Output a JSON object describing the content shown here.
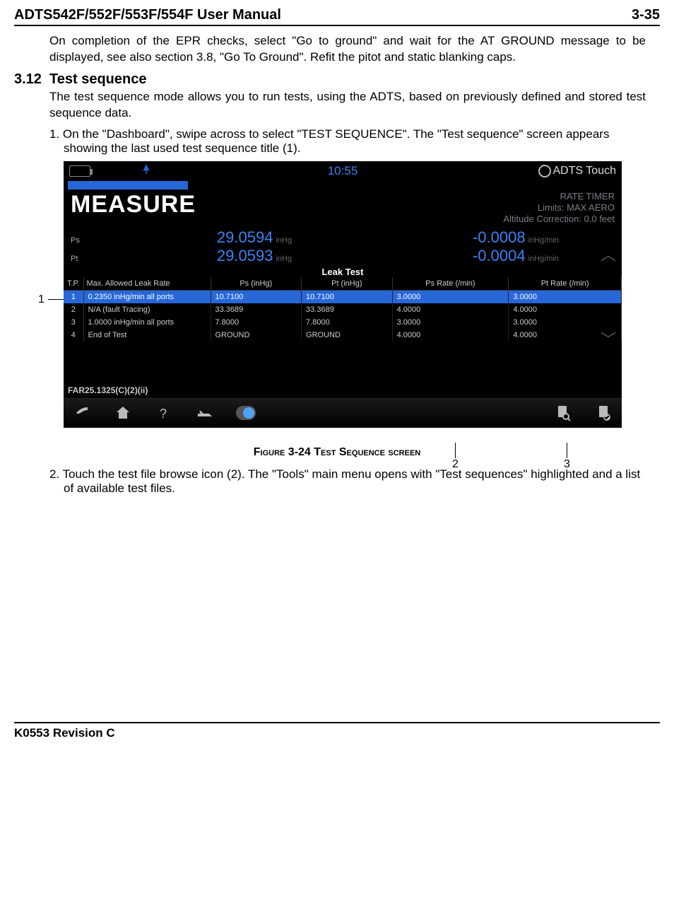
{
  "header": {
    "title": "ADTS542F/552F/553F/554F User Manual",
    "pagenum": "3-35"
  },
  "para_pre": "On completion of the EPR checks, select \"Go to ground\" and wait for the AT GROUND message to be displayed, see also section 3.8, \"Go To Ground\". Refit the pitot and static blanking caps.",
  "section": {
    "num": "3.12",
    "title": "Test sequence"
  },
  "para_intro": "The test sequence mode allows you to run tests, using the ADTS, based on previously defined and stored test sequence data.",
  "step1": "1. On the \"Dashboard\", swipe across to select \"TEST SEQUENCE\". The \"Test sequence\" screen appears showing the last used test sequence title (1).",
  "callouts": {
    "c1": "1",
    "c2": "2",
    "c3": "3"
  },
  "device": {
    "clock": "10:55",
    "brand": "ADTS Touch",
    "rate_timer": "RATE TIMER",
    "limits": "Limits: MAX AERO",
    "altcorr": "Altitude Correction: 0.0 feet",
    "measure": "MEASURE",
    "readings": {
      "ps_label": "Ps",
      "ps_val": "29.0594",
      "ps_unit": "inHg",
      "ps_rate": "-0.0008",
      "ps_rate_unit": "inHg/min",
      "pt_label": "Pt",
      "pt_val": "29.0593",
      "pt_unit": "inHg",
      "pt_rate": "-0.0004",
      "pt_rate_unit": "inHg/min"
    },
    "table": {
      "title": "Leak Test",
      "headers": {
        "tp": "T.P.",
        "desc": "Max. Allowed Leak Rate",
        "ps": "Ps\n(inHg)",
        "pt": "Pt\n(inHg)",
        "psr": "Ps Rate\n(/min)",
        "ptr": "Pt Rate\n(/min)"
      },
      "rows": [
        {
          "n": "1",
          "desc": "0.2350 inHg/min all ports",
          "ps": "10.7100",
          "pt": "10.7100",
          "psr": "3.0000",
          "ptr": "3.0000",
          "sel": true
        },
        {
          "n": "2",
          "desc": "N/A  (fault Tracing)",
          "ps": "33.3689",
          "pt": "33.3689",
          "psr": "4.0000",
          "ptr": "4.0000"
        },
        {
          "n": "3",
          "desc": "1.0000 inHg/min all ports",
          "ps": "7.8000",
          "pt": "7.8000",
          "psr": "3.0000",
          "ptr": "3.0000"
        },
        {
          "n": "4",
          "desc": "End of Test",
          "ps": "GROUND",
          "pt": "GROUND",
          "psr": "4.0000",
          "ptr": "4.0000"
        }
      ]
    },
    "far": "FAR25.1325(C)(2)(ii)"
  },
  "figure_caption_prefix": "Figure 3-24 T",
  "figure_caption_rest": "est Sequence screen",
  "step2": "2. Touch the test file browse icon (2). The \"Tools\" main menu opens with \"Test sequences\" highlighted and a list of available test files.",
  "footer": "K0553 Revision C"
}
